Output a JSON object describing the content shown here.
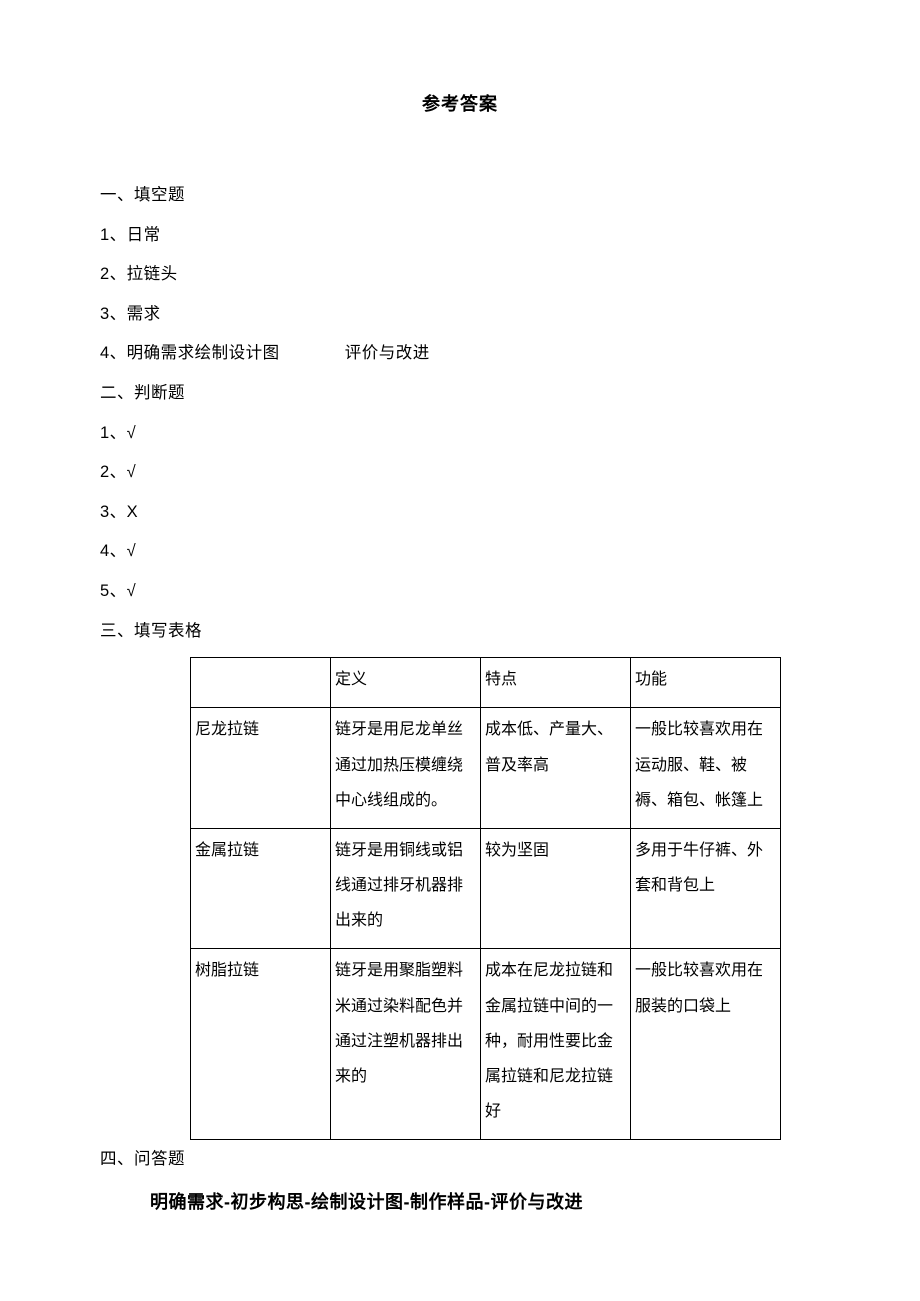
{
  "title": "参考答案",
  "sections": {
    "s1": {
      "heading": "一、填空题",
      "items": {
        "i1": "1、日常",
        "i2": "2、拉链头",
        "i3": "3、需求",
        "i4a": "4、明确需求绘制设计图",
        "i4b": "评价与改进"
      }
    },
    "s2": {
      "heading": "二、判断题",
      "items": {
        "j1": "1、√",
        "j2": "2、√",
        "j3": "3、X",
        "j4": "4、√",
        "j5": "5、√"
      }
    },
    "s3": {
      "heading": "三、填写表格",
      "table": {
        "header": {
          "c0": "",
          "c1": "定义",
          "c2": "特点",
          "c3": "功能"
        },
        "rows": [
          {
            "name": "尼龙拉链",
            "def": "链牙是用尼龙单丝通过加热压模缠绕中心线组成的。",
            "feat": "成本低、产量大、普及率高",
            "func": "一般比较喜欢用在运动服、鞋、被褥、箱包、帐篷上"
          },
          {
            "name": "金属拉链",
            "def": "链牙是用铜线或铝线通过排牙机器排出来的",
            "feat": "较为坚固",
            "func": "多用于牛仔裤、外套和背包上"
          },
          {
            "name": "树脂拉链",
            "def": "链牙是用聚脂塑料米通过染料配色并通过注塑机器排出来的",
            "feat": "成本在尼龙拉链和金属拉链中间的一种，耐用性要比金属拉链和尼龙拉链好",
            "func": "一般比较喜欢用在服装的口袋上"
          }
        ]
      }
    },
    "s4": {
      "heading": "四、问答题",
      "answer": "明确需求-初步构思-绘制设计图-制作样品-评价与改进"
    }
  }
}
